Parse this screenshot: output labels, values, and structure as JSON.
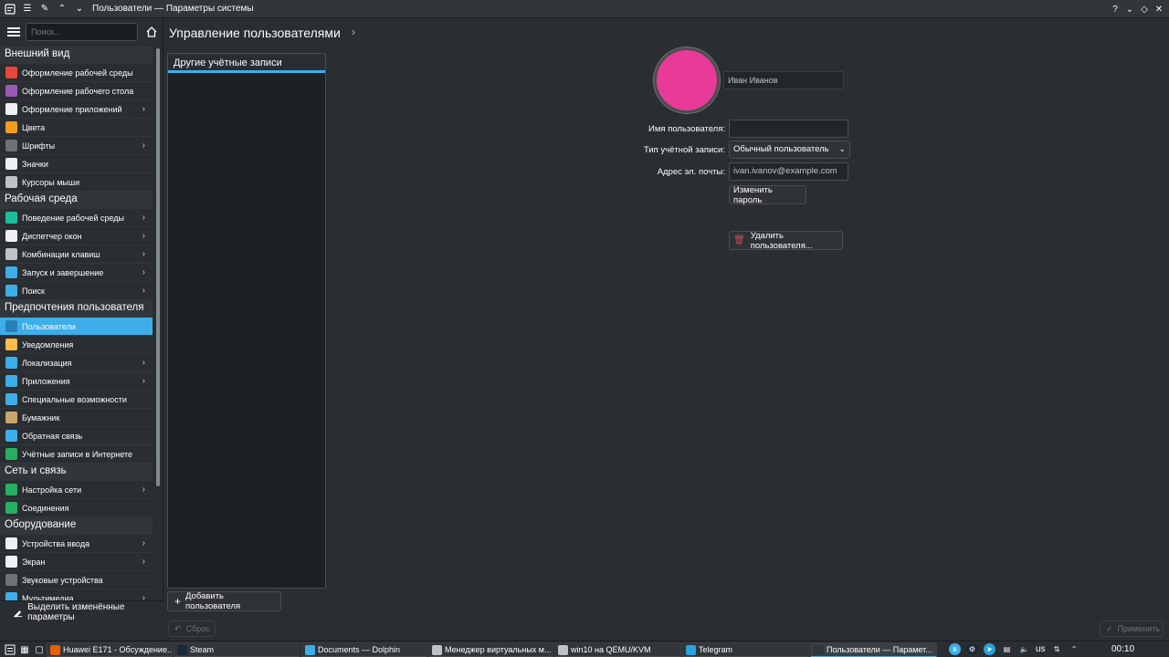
{
  "window": {
    "title": "Пользователи — Параметры системы",
    "buttons": [
      "?",
      "⌄",
      "◇",
      "✕"
    ]
  },
  "sidebar": {
    "search_placeholder": "Поиск...",
    "groups": [
      {
        "title": "Внешний вид",
        "items": [
          {
            "label": "Оформление рабочей среды",
            "chev": false,
            "color": "#e8453c"
          },
          {
            "label": "Оформление рабочего стола",
            "chev": false,
            "color": "#9b59b6"
          },
          {
            "label": "Оформление приложений",
            "chev": true,
            "color": "#eff0f1"
          },
          {
            "label": "Цвета",
            "chev": false,
            "color": "#f39c1f"
          },
          {
            "label": "Шрифты",
            "chev": true,
            "color": "#6e7175"
          },
          {
            "label": "Значки",
            "chev": false,
            "color": "#eff0f1"
          },
          {
            "label": "Курсоры мыши",
            "chev": false,
            "color": "#bdc3c7"
          }
        ]
      },
      {
        "title": "Рабочая среда",
        "items": [
          {
            "label": "Поведение рабочей среды",
            "chev": true,
            "color": "#1abc9c"
          },
          {
            "label": "Диспетчер окон",
            "chev": true,
            "color": "#eff0f1"
          },
          {
            "label": "Комбинации клавиш",
            "chev": true,
            "color": "#bdc3c7"
          },
          {
            "label": "Запуск и завершение",
            "chev": true,
            "color": "#3daee9"
          },
          {
            "label": "Поиск",
            "chev": true,
            "color": "#3daee9"
          }
        ]
      },
      {
        "title": "Предпочтения пользователя",
        "items": [
          {
            "label": "Пользователи",
            "chev": false,
            "color": "#2980b9",
            "active": true
          },
          {
            "label": "Уведомления",
            "chev": false,
            "color": "#fdbc4b"
          },
          {
            "label": "Локализация",
            "chev": true,
            "color": "#3daee9"
          },
          {
            "label": "Приложения",
            "chev": true,
            "color": "#3daee9"
          },
          {
            "label": "Специальные возможности",
            "chev": false,
            "color": "#3daee9"
          },
          {
            "label": "Бумажник",
            "chev": false,
            "color": "#c9a66b"
          },
          {
            "label": "Обратная связь",
            "chev": false,
            "color": "#3daee9"
          },
          {
            "label": "Учётные записи в Интернете",
            "chev": false,
            "color": "#27ae60"
          }
        ]
      },
      {
        "title": "Сеть и связь",
        "items": [
          {
            "label": "Настройка сети",
            "chev": true,
            "color": "#27ae60"
          },
          {
            "label": "Соединения",
            "chev": false,
            "color": "#27ae60"
          }
        ]
      },
      {
        "title": "Оборудование",
        "items": [
          {
            "label": "Устройства ввода",
            "chev": true,
            "color": "#eff0f1"
          },
          {
            "label": "Экран",
            "chev": true,
            "color": "#eff0f1"
          },
          {
            "label": "Звуковые устройства",
            "chev": false,
            "color": "#6e7175"
          },
          {
            "label": "Мультимедиа",
            "chev": true,
            "color": "#3daee9"
          }
        ]
      }
    ],
    "footer_label": "Выделить изменённые параметры"
  },
  "main": {
    "page_title": "Управление пользователями",
    "list_header": "Другие учётные записи",
    "add_user_label": "Добавить пользователя",
    "avatar_color": "#e93a9a",
    "full_name": "Иван Иванов",
    "username_label": "Имя пользователя:",
    "username_value": "",
    "account_type_label": "Тип учётной записи:",
    "account_type_value": "Обычный пользователь",
    "email_label": "Адрес эл. почты:",
    "email_value": "ivan.ivanov@example.com",
    "change_password_label": "Изменить пароль",
    "delete_user_label": "Удалить пользователя...",
    "reset_label": "Сброс",
    "apply_label": "Применить"
  },
  "taskbar": {
    "tasks": [
      {
        "label": "Huawei E171 - Обсуждение...",
        "color": "#e66000"
      },
      {
        "label": "Steam",
        "color": "#1b2838"
      },
      {
        "label": "Documents — Dolphin",
        "color": "#3daee9"
      },
      {
        "label": "Менеджер виртуальных м...",
        "color": "#bdc3c7"
      },
      {
        "label": "win10 на QEMU/KVM",
        "color": "#bdc3c7"
      },
      {
        "label": "Telegram",
        "color": "#2aa1da"
      },
      {
        "label": "Пользователи — Парамет...",
        "color": "#31363b",
        "active": true
      }
    ],
    "layout": "us",
    "clock": "00:10"
  }
}
